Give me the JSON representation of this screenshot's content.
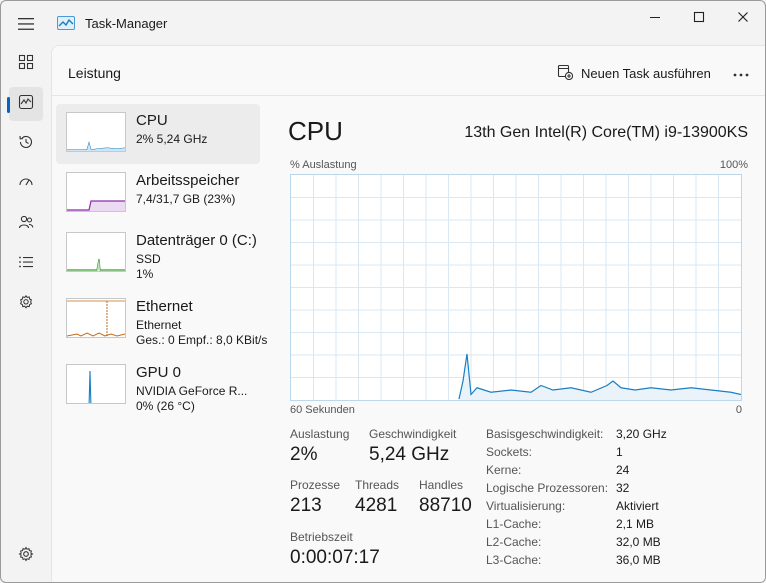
{
  "window": {
    "title": "Task-Manager"
  },
  "nav": {
    "items": [
      {
        "icon": "processes-icon"
      },
      {
        "icon": "performance-icon"
      },
      {
        "icon": "app-history-icon"
      },
      {
        "icon": "startup-apps-icon"
      },
      {
        "icon": "users-icon"
      },
      {
        "icon": "details-icon"
      },
      {
        "icon": "services-icon"
      }
    ],
    "settings_icon": "gear-icon"
  },
  "header": {
    "title": "Leistung",
    "new_task_label": "Neuen Task ausführen"
  },
  "perf_list": [
    {
      "name": "CPU",
      "line1": "2%  5,24 GHz",
      "line2": "",
      "line3": "",
      "color": "#1a7fc1"
    },
    {
      "name": "Arbeitsspeicher",
      "line1": "7,4/31,7 GB (23%)",
      "line2": "",
      "line3": "",
      "color": "#8b2fa8"
    },
    {
      "name": "Datenträger 0 (C:)",
      "line1": "SSD",
      "line2": "1%",
      "line3": "",
      "color": "#3a9b32"
    },
    {
      "name": "Ethernet",
      "line1": "Ethernet",
      "line2": "Ges.: 0 Empf.: 8,0 KBit/s",
      "line3": "",
      "color": "#c56a1a"
    },
    {
      "name": "GPU 0",
      "line1": "NVIDIA GeForce R...",
      "line2": "0%  (26 °C)",
      "line3": "",
      "color": "#1a7fc1"
    }
  ],
  "detail": {
    "title": "CPU",
    "model": "13th Gen Intel(R) Core(TM) i9-13900KS",
    "graph": {
      "y_label": "% Auslastung",
      "y_max_label": "100%",
      "x_left_label": "60 Sekunden",
      "x_right_label": "0",
      "line_color": "#1a7fc1",
      "grid_color": "#d9e8f3"
    },
    "stats": {
      "utilization_label": "Auslastung",
      "utilization_value": "2%",
      "speed_label": "Geschwindigkeit",
      "speed_value": "5,24 GHz",
      "processes_label": "Prozesse",
      "processes_value": "213",
      "threads_label": "Threads",
      "threads_value": "4281",
      "handles_label": "Handles",
      "handles_value": "88710",
      "uptime_label": "Betriebszeit",
      "uptime_value": "0:00:07:17"
    },
    "specs": [
      {
        "key": "Basisgeschwindigkeit:",
        "value": "3,20 GHz"
      },
      {
        "key": "Sockets:",
        "value": "1"
      },
      {
        "key": "Kerne:",
        "value": "24"
      },
      {
        "key": "Logische Prozessoren:",
        "value": "32"
      },
      {
        "key": "Virtualisierung:",
        "value": "Aktiviert"
      },
      {
        "key": "L1-Cache:",
        "value": "2,1 MB"
      },
      {
        "key": "L2-Cache:",
        "value": "32,0 MB"
      },
      {
        "key": "L3-Cache:",
        "value": "36,0 MB"
      }
    ]
  }
}
